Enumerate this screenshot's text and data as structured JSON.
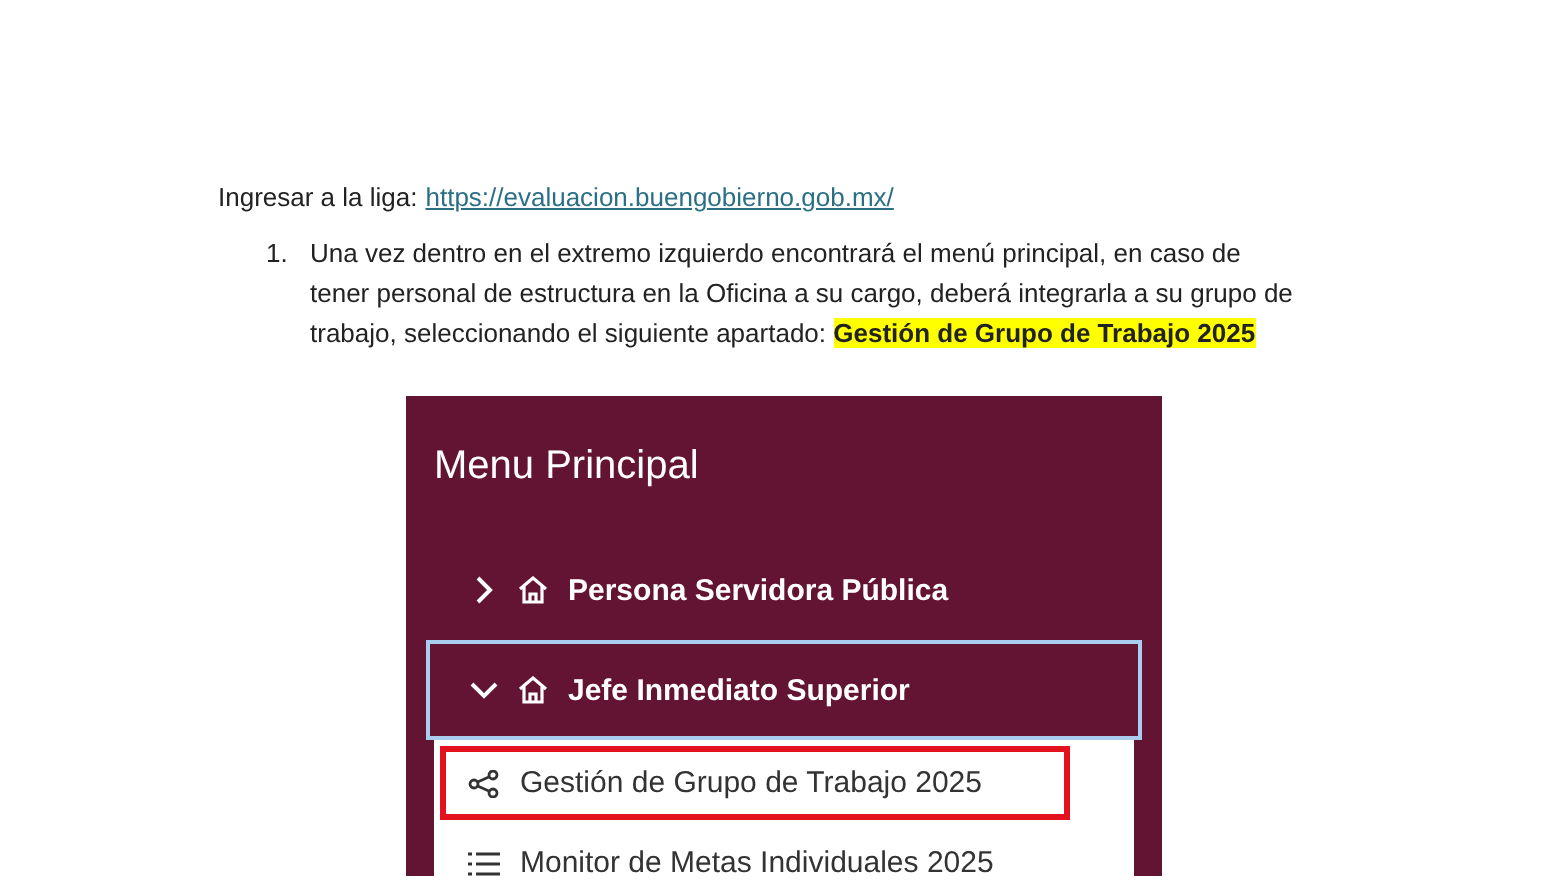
{
  "intro": {
    "label": "Ingresar a la liga:",
    "link": "https://evaluacion.buengobierno.gob.mx/"
  },
  "steps": [
    {
      "number": "1.",
      "text": "Una vez dentro en el extremo izquierdo encontrará el menú principal, en caso de tener personal de estructura en la Oficina a su cargo, deberá integrarla a su grupo de trabajo, seleccionando el siguiente apartado: **Gestión de Grupo de Trabajo 2025**"
    }
  ],
  "menu_screenshot": {
    "title": "Menu Principal",
    "items": [
      {
        "label": "Persona Servidora Pública",
        "expanded": false,
        "focused": false
      },
      {
        "label": "Jefe Inmediato Superior",
        "expanded": true,
        "focused": true,
        "children": [
          {
            "label": "Gestión de Grupo de Trabajo 2025",
            "kind": "share",
            "highlighted": true
          },
          {
            "label": "Monitor de Metas Individuales 2025",
            "kind": "list",
            "highlighted": false
          }
        ]
      }
    ]
  }
}
